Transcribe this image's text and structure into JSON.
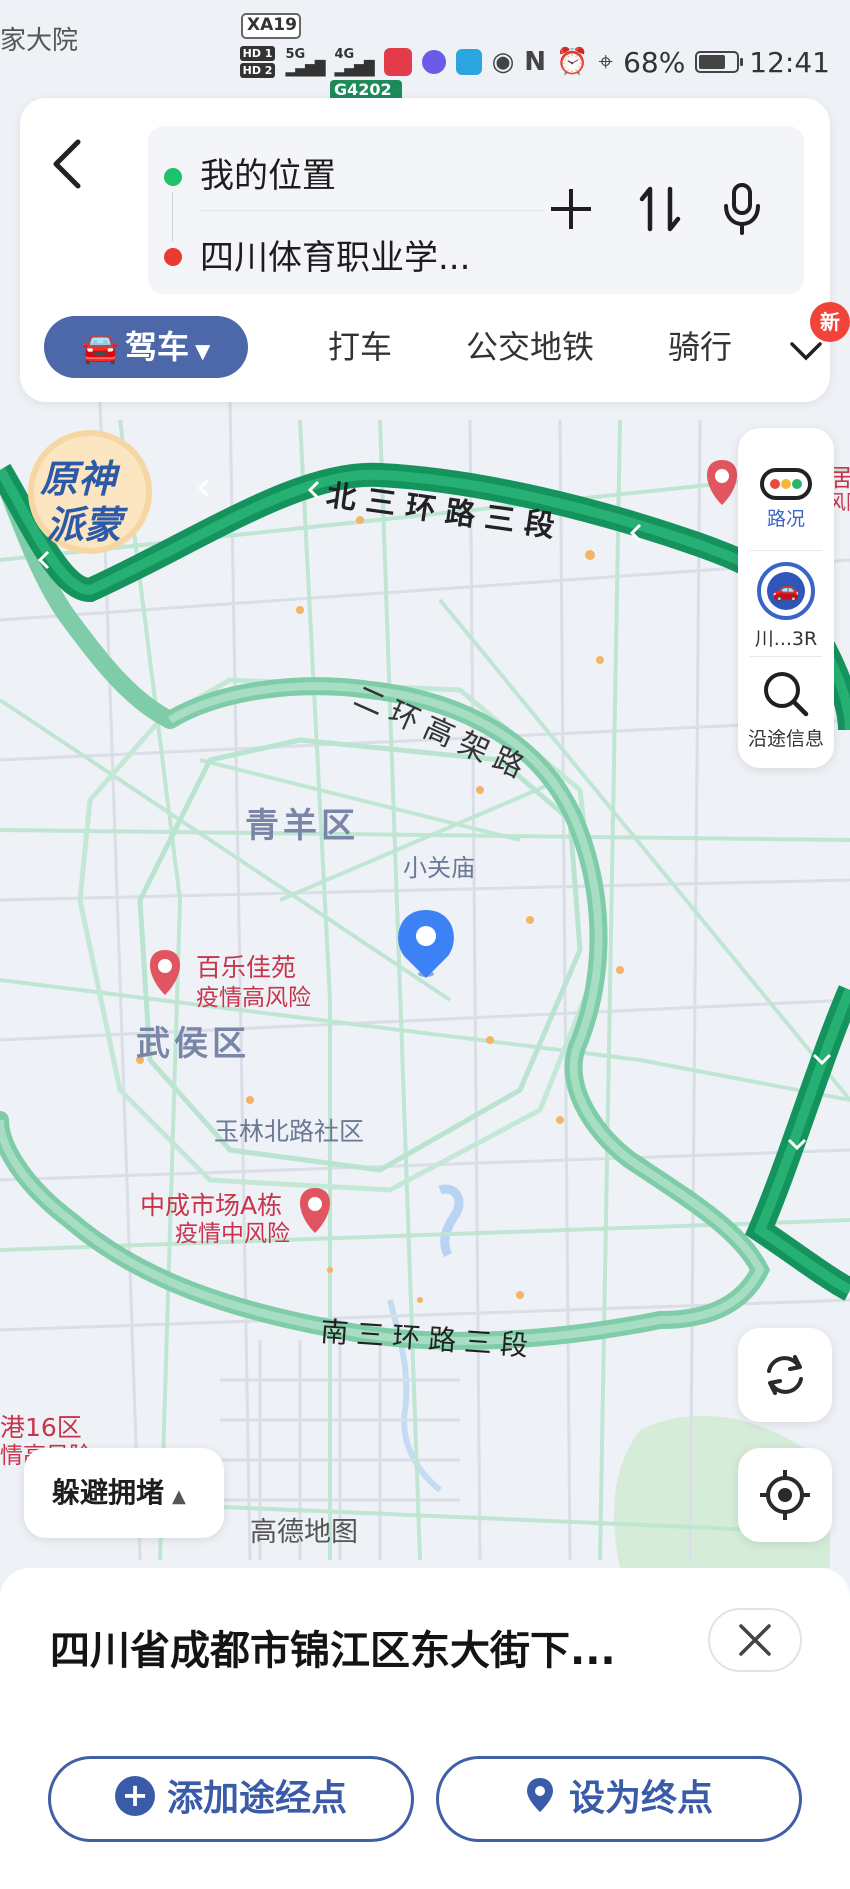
{
  "status_bar": {
    "network_1": "HD 1",
    "network_2": "HD 2",
    "gen_1": "5G",
    "gen_2": "4G",
    "battery": "68%",
    "battery_level": 0.68,
    "time": "12:41",
    "icons": [
      "eye-icon",
      "nfc-icon",
      "alarm-icon",
      "location-icon"
    ]
  },
  "route": {
    "origin": "我的位置",
    "destination": "四川体育职业学...",
    "origin_color": "#1fc16b",
    "destination_color": "#ea3b31"
  },
  "modes": {
    "drive": "驾车",
    "taxi": "打车",
    "transit": "公交地铁",
    "bike": "骑行",
    "new_badge": "新"
  },
  "side_panel": {
    "traffic": "路况",
    "plate": "川...3R",
    "along_route": "沿途信息"
  },
  "map_labels": {
    "top_left": "家大院",
    "road_xa19": "XA19",
    "road_g4202": "G4202",
    "north_ring": "北三环路三段",
    "second_ring": "二环高架路",
    "south_ring": "南三环路三段",
    "qingyang": "青羊区",
    "xiaoguanmiao": "小关庙",
    "wuhou": "武侯区",
    "yulin": "玉林北路社区",
    "bailejia_name": "百乐佳苑",
    "bailejia_risk": "疫情高风险",
    "zhongcheng_name": "中成市场A栋",
    "zhongcheng_risk": "疫情中风险",
    "gang16_name": "港16区",
    "gang16_risk": "情高风险",
    "right_top_1": "居",
    "right_top_2": "风险",
    "genshin_1": "原神",
    "genshin_2": "派蒙",
    "watermark": "高德地图"
  },
  "avoid_congestion": "躲避拥堵",
  "sheet": {
    "address": "四川省成都市锦江区东大街下...",
    "add_waypoint": "添加途经点",
    "set_destination": "设为终点"
  },
  "colors": {
    "accent": "#4c68a9",
    "ring_road": "#7fcca8",
    "expressway": "#14935d",
    "risk_pin": "#e05560",
    "location_pin": "#3d82f5"
  }
}
